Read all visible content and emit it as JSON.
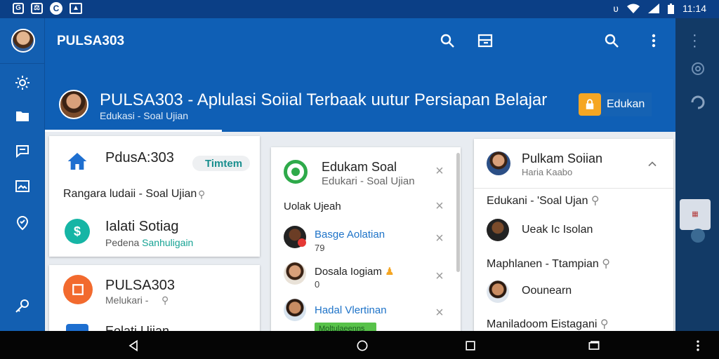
{
  "status_bar": {
    "left_icons": [
      "gallery-icon",
      "sim-icon",
      "app-c-icon",
      "image-icon"
    ],
    "left_box1": "G",
    "left_box2": "⚖",
    "left_round": "C",
    "time": "11:14"
  },
  "app": {
    "title": "PULSA303"
  },
  "hero": {
    "title": "PULSA303 - Aplulasi Soiial Terbaak uutur Persiapan Belajar",
    "subtitle": "Edukasi - Soal Ujian",
    "action_label": "Edukan"
  },
  "cards": {
    "left_top": {
      "title": "PdusA:303",
      "toggle_label": "Timtem",
      "line": "Rangara ludaii - Soal Ujian",
      "item_title": "Ialati Sotiag",
      "item_sub_prefix": "Pedena",
      "item_sub_link": "Sanhuligain"
    },
    "left_bottom": {
      "title": "PULSA303",
      "subtitle": "Melukari -",
      "next_title": "Eolati Ujian"
    },
    "middle": {
      "title": "Edukam Soal",
      "subtitle": "Edukari - Soal Ujian",
      "section": "Uolak Ujeah",
      "items": [
        {
          "name": "Basge Aolatian",
          "value": "79"
        },
        {
          "name": "Dosala Iogiam",
          "value": "0"
        },
        {
          "name": "Hadal Vlertinan",
          "value": ""
        }
      ],
      "badge": "Moltulaeenns"
    },
    "right": {
      "title": "Pulkam Soiian",
      "subtitle": "Haria Kaabo",
      "rows": [
        "Edukani - 'Soal Ujan",
        "Ueak Ic Isolan",
        "Maphlanen - Ttampian",
        "Oounearn",
        "Maniladoom Eistagani"
      ]
    }
  },
  "colors": {
    "primary": "#0f5fb5",
    "status_bar": "#0b3f86",
    "accent_orange": "#f5a623",
    "accent_teal": "#16b5a5",
    "accent_green": "#2eaa4a",
    "accent_red_orange": "#f26a2e"
  }
}
